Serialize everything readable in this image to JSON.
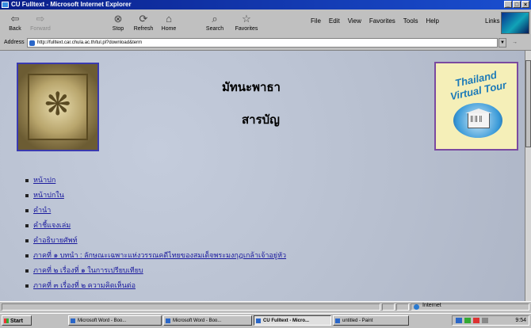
{
  "window": {
    "title": "CU Fulltext - Microsoft Internet Explorer"
  },
  "toolbar": {
    "buttons": [
      {
        "label": "Back",
        "icon": "back-arrow-icon"
      },
      {
        "label": "Forward",
        "icon": "forward-arrow-icon"
      },
      {
        "label": "Stop",
        "icon": "stop-icon"
      },
      {
        "label": "Refresh",
        "icon": "refresh-icon"
      },
      {
        "label": "Home",
        "icon": "home-icon"
      },
      {
        "label": "Search",
        "icon": "search-icon"
      },
      {
        "label": "Favorites",
        "icon": "favorites-icon"
      }
    ],
    "menus": [
      "File",
      "Edit",
      "View",
      "Favorites",
      "Tools",
      "Help"
    ],
    "links_label": "Links"
  },
  "address": {
    "label": "Address",
    "url": "http://fulltext.car.chula.ac.th/tul.pl?download&term"
  },
  "page": {
    "heading1": "มัทนะพาธา",
    "heading2": "สารบัญ",
    "logo_text": "Thailand Virtual Tour",
    "links": [
      "หน้าปก",
      "หน้าปกใน",
      "คำนำ",
      "คำชี้แจงเล่ม",
      "คำอธิบายศัพท์",
      "ภาคที่ ๑ บทนำ : ลักษณะเฉพาะแห่งวรรณคดีไทยของสมเด็จพระมงกุฎเกล้าเจ้าอยู่หัว",
      "ภาคที่ ๒ เรื่องที่ ๑ ในการเปรียบเทียบ",
      "ภาคที่ ๓ เรื่องที่ ๒ ความคิดเห็นต่อ"
    ]
  },
  "status": {
    "zone": "Internet"
  },
  "taskbar": {
    "start_label": "Start",
    "tasks": [
      {
        "label": "Microsoft Word - Boo...",
        "active": false
      },
      {
        "label": "Microsoft Word - Boo...",
        "active": false
      },
      {
        "label": "CU Fulltext - Micro...",
        "active": true
      },
      {
        "label": "untitled - Paint",
        "active": false
      }
    ],
    "clock": "9:54"
  }
}
